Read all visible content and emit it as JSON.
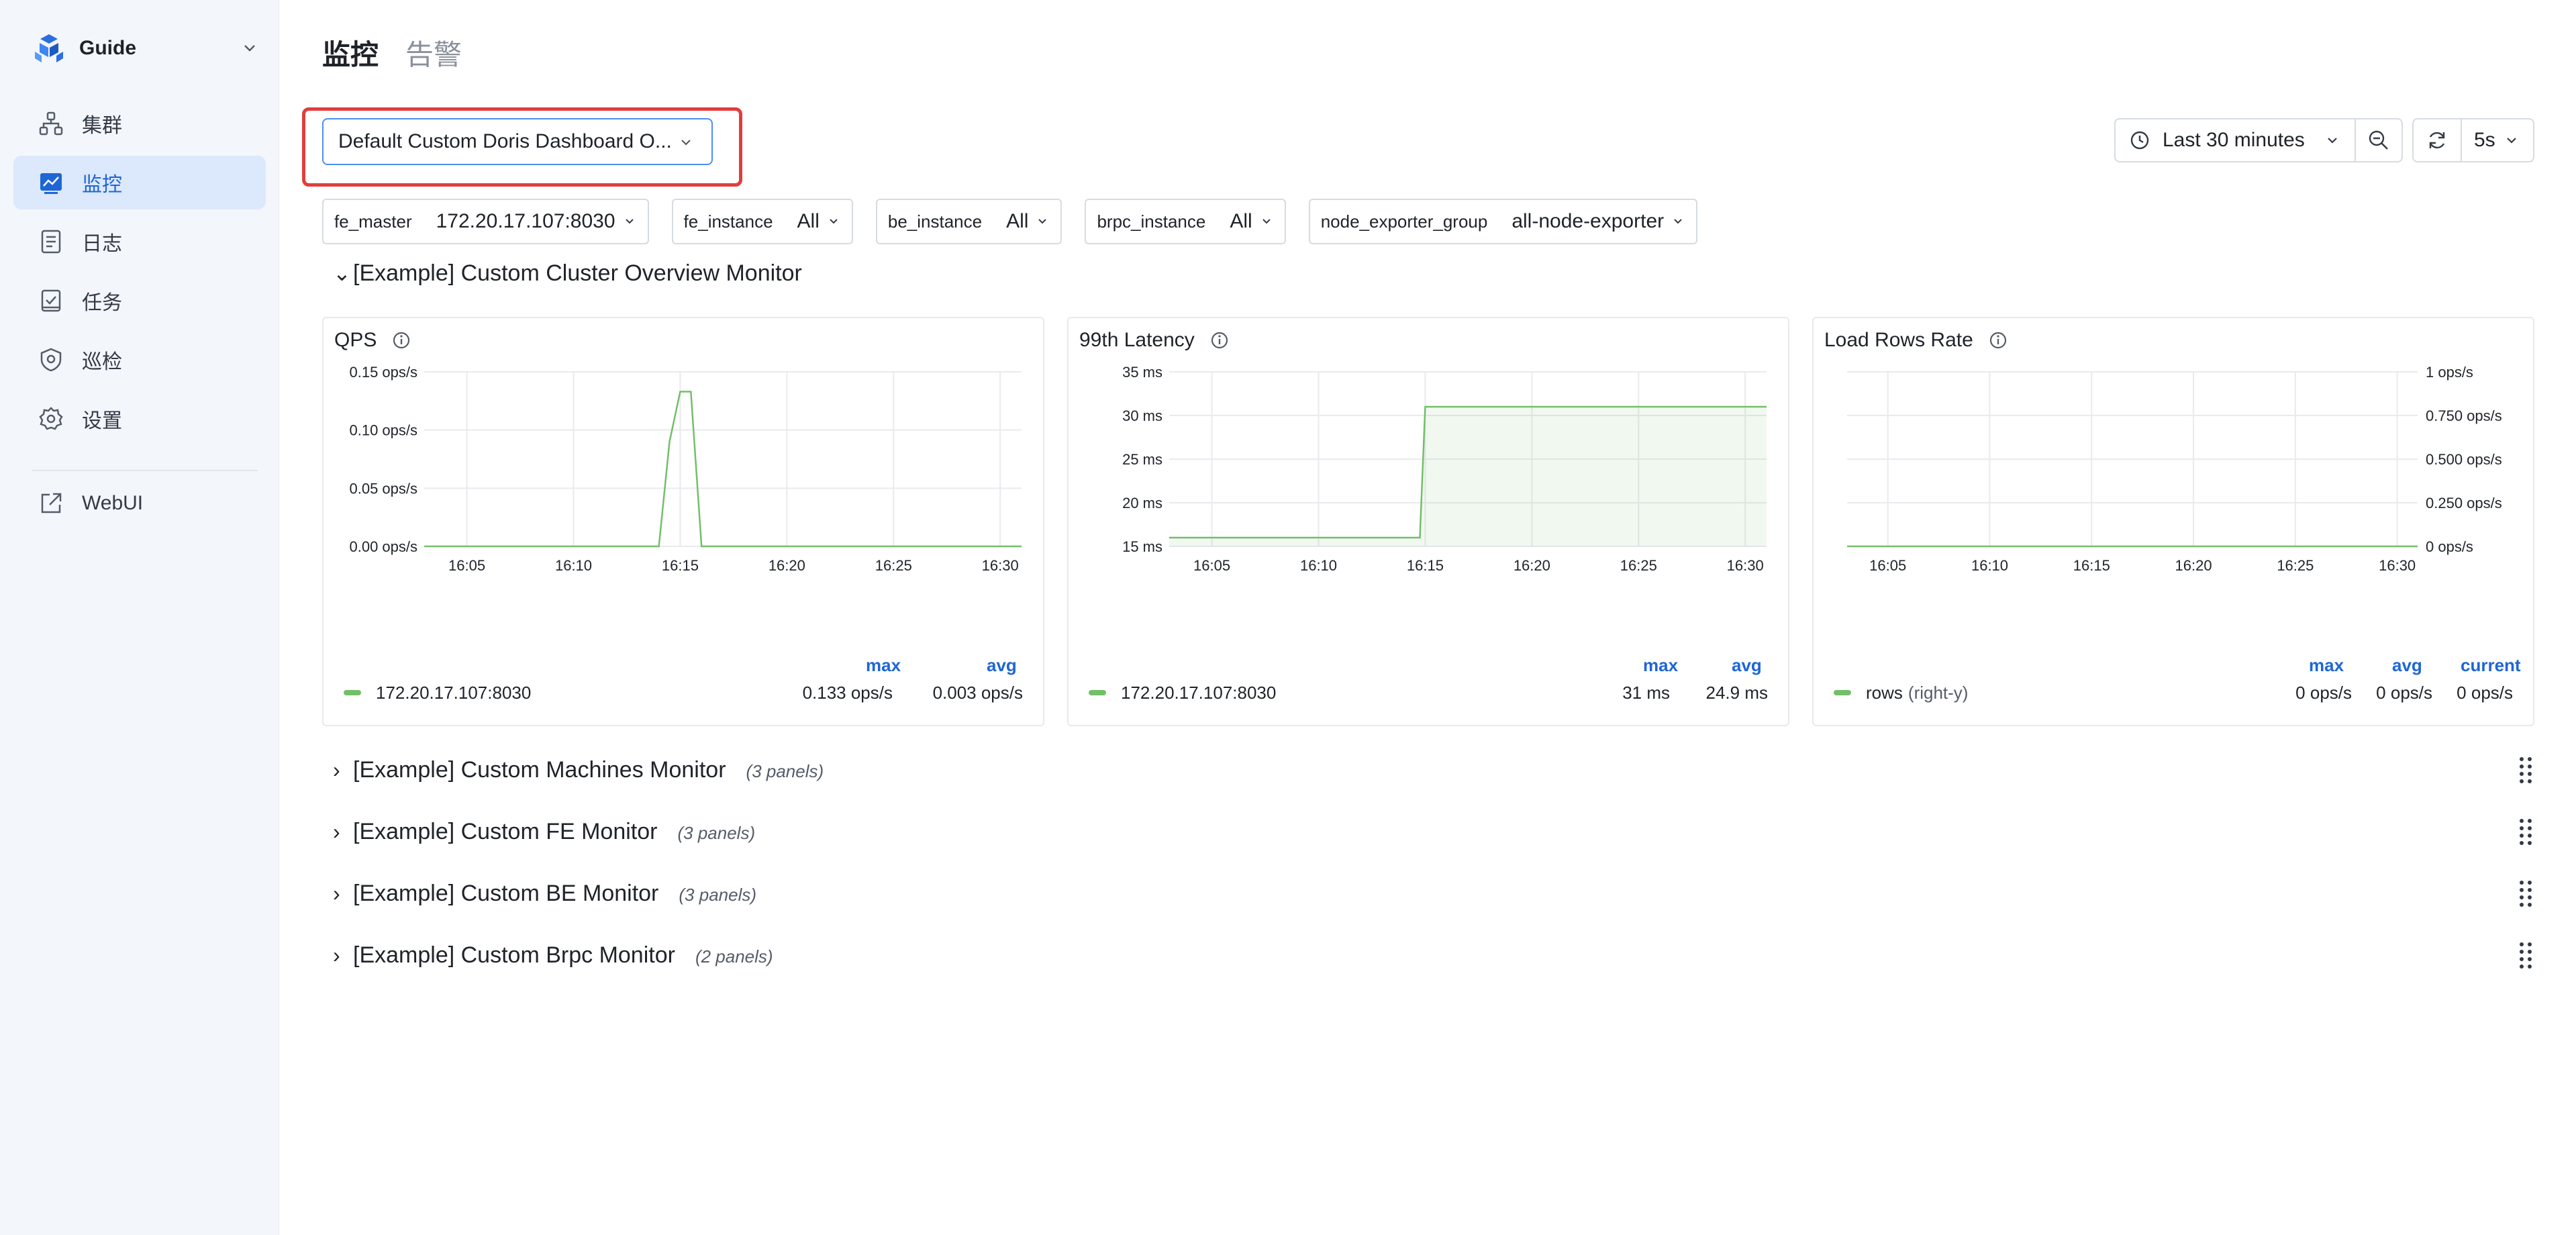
{
  "sidebar": {
    "workspace": "Guide",
    "items": [
      {
        "label": "集群",
        "icon": "cluster-icon"
      },
      {
        "label": "监控",
        "icon": "monitor-chart-icon",
        "active": true
      },
      {
        "label": "日志",
        "icon": "log-document-icon"
      },
      {
        "label": "任务",
        "icon": "task-icon"
      },
      {
        "label": "巡检",
        "icon": "shield-icon"
      },
      {
        "label": "设置",
        "icon": "gear-icon"
      }
    ],
    "webui": {
      "label": "WebUI",
      "icon": "external-link-icon"
    }
  },
  "tabs": [
    {
      "label": "监控",
      "active": true
    },
    {
      "label": "告警",
      "active": false
    }
  ],
  "dashboard_select": {
    "value": "Default Custom Doris Dashboard O..."
  },
  "time_picker": {
    "range": "Last 30 minutes",
    "refresh_interval": "5s"
  },
  "variables": [
    {
      "key": "fe_master",
      "value": "172.20.17.107:8030"
    },
    {
      "key": "fe_instance",
      "value": "All"
    },
    {
      "key": "be_instance",
      "value": "All"
    },
    {
      "key": "brpc_instance",
      "value": "All"
    },
    {
      "key": "node_exporter_group",
      "value": "all-node-exporter"
    }
  ],
  "rows": [
    {
      "title": "[Example] Custom Cluster Overview Monitor",
      "expanded": true,
      "count": ""
    },
    {
      "title": "[Example] Custom Machines Monitor",
      "expanded": false,
      "count": "(3 panels)"
    },
    {
      "title": "[Example] Custom FE Monitor",
      "expanded": false,
      "count": "(3 panels)"
    },
    {
      "title": "[Example] Custom BE Monitor",
      "expanded": false,
      "count": "(3 panels)"
    },
    {
      "title": "[Example] Custom Brpc Monitor",
      "expanded": false,
      "count": "(2 panels)"
    }
  ],
  "colors": {
    "accent": "#1e66d6",
    "series": "#73bf69",
    "highlight": "#e13d3d"
  },
  "chart_data": [
    {
      "type": "line",
      "title": "QPS",
      "x_ticks": [
        "16:05",
        "16:10",
        "16:15",
        "16:20",
        "16:25",
        "16:30"
      ],
      "y_ticks": [
        "0.00 ops/s",
        "0.05 ops/s",
        "0.10 ops/s",
        "0.15 ops/s"
      ],
      "ylim": [
        0,
        0.15
      ],
      "axis_side": "left",
      "series": [
        {
          "name": "172.20.17.107:8030",
          "x": [
            "16:03",
            "16:14",
            "16:14:30",
            "16:15",
            "16:15:30",
            "16:16",
            "16:31"
          ],
          "values": [
            0,
            0,
            0.09,
            0.133,
            0.133,
            0,
            0
          ],
          "fill": false
        }
      ],
      "legend_columns": [
        "max",
        "avg"
      ],
      "legend_values": [
        [
          "0.133 ops/s",
          "0.003 ops/s"
        ]
      ]
    },
    {
      "type": "area",
      "title": "99th Latency",
      "x_ticks": [
        "16:05",
        "16:10",
        "16:15",
        "16:20",
        "16:25",
        "16:30"
      ],
      "y_ticks": [
        "15 ms",
        "20 ms",
        "25 ms",
        "30 ms",
        "35 ms"
      ],
      "ylim": [
        15,
        35
      ],
      "axis_side": "left",
      "series": [
        {
          "name": "172.20.17.107:8030",
          "x": [
            "16:03",
            "16:14:45",
            "16:15",
            "16:31"
          ],
          "values": [
            16,
            16,
            31,
            31
          ],
          "fill": true
        }
      ],
      "legend_columns": [
        "max",
        "avg"
      ],
      "legend_values": [
        [
          "31 ms",
          "24.9 ms"
        ]
      ]
    },
    {
      "type": "line",
      "title": "Load Rows Rate",
      "x_ticks": [
        "16:05",
        "16:10",
        "16:15",
        "16:20",
        "16:25",
        "16:30"
      ],
      "y_ticks": [
        "0 ops/s",
        "0.250 ops/s",
        "0.500 ops/s",
        "0.750 ops/s",
        "1 ops/s"
      ],
      "ylim": [
        0,
        1
      ],
      "axis_side": "right",
      "series": [
        {
          "name": "rows",
          "suffix": "(right-y)",
          "x": [
            "16:03",
            "16:31"
          ],
          "values": [
            0,
            0
          ],
          "fill": false
        }
      ],
      "legend_columns": [
        "max",
        "avg",
        "current"
      ],
      "legend_values": [
        [
          "0 ops/s",
          "0 ops/s",
          "0 ops/s"
        ]
      ]
    }
  ]
}
